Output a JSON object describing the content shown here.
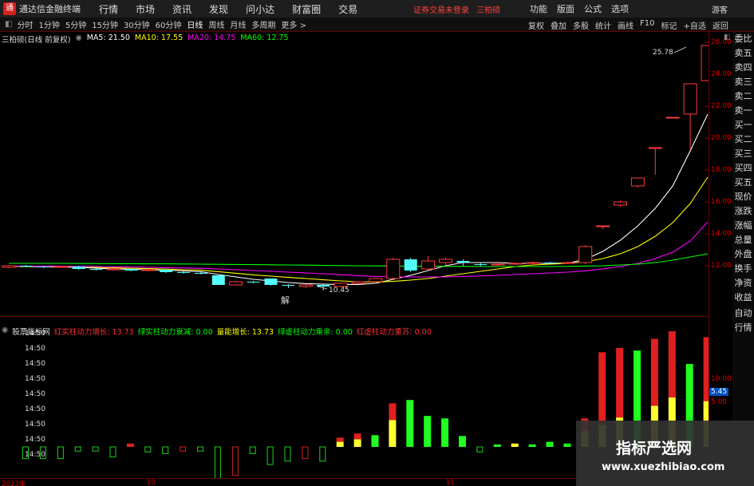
{
  "menubar": {
    "app_title": "通达信金融终端",
    "items": [
      "行情",
      "市场",
      "资讯",
      "发现",
      "问小达",
      "财富圈",
      "交易"
    ],
    "login_status": "证券交易未登录",
    "stock_label": "三柏硕",
    "right_items": [
      "功能",
      "版面",
      "公式",
      "选项"
    ],
    "guest": "游客"
  },
  "toolbar": {
    "periods": [
      "分时",
      "1分钟",
      "5分钟",
      "15分钟",
      "30分钟",
      "60分钟",
      "日线",
      "周线",
      "月线",
      "多周期",
      "更多 >"
    ],
    "active_period": "日线",
    "right_items": [
      "复权",
      "叠加",
      "多股",
      "统计",
      "画线",
      "F10",
      "标记",
      "+自选",
      "返回"
    ]
  },
  "info": {
    "stock_name": "三柏硕(日线 前复权)",
    "ma5": "MA5: 21.50",
    "ma10": "MA10: 17.55",
    "ma20": "MA20: 14.75",
    "ma60": "MA60: 12.75",
    "colors": {
      "ma5": "#ffffff",
      "ma10": "#ffff00",
      "ma20": "#ff00ff",
      "ma60": "#00ff00"
    }
  },
  "indicator": {
    "name": "股票指标网",
    "items": [
      {
        "label": "红实柱动力增长: 13.73",
        "color": "#ff3030"
      },
      {
        "label": "绿实柱动力衰减: 0.00",
        "color": "#00ff00"
      },
      {
        "label": "量能增长: 13.73",
        "color": "#ffff00"
      },
      {
        "label": "绿虚柱动力乘亲: 0.00",
        "color": "#00ff00"
      },
      {
        "label": "红虚柱动力重苏: 0.00",
        "color": "#ff3030"
      }
    ]
  },
  "price_axis": [
    "26.00",
    "24.00",
    "22.00",
    "20.00",
    "18.00",
    "16.00",
    "14.00",
    "12.00"
  ],
  "vol_axis": [
    "10.00",
    "5.00"
  ],
  "vol_current": "5.45",
  "high_label": "25.78",
  "low_label": "10.45",
  "marker_label": "解",
  "side_panel": [
    "委比",
    "卖五",
    "卖四",
    "卖三",
    "卖二",
    "卖一",
    "买一",
    "买二",
    "买三",
    "买四",
    "买五",
    "现价",
    "涨跌",
    "涨幅",
    "总量",
    "外盘",
    "换手",
    "净资",
    "收益",
    "自动",
    "行情"
  ],
  "time_labels": [
    "14:50",
    "14:50",
    "14:50",
    "14:50",
    "14:50",
    "14:50",
    "14:50",
    "14:50",
    "14:50"
  ],
  "date_axis": [
    "2023年",
    "10",
    "11"
  ],
  "watermark": {
    "title": "指标严选网",
    "url": "www.xuezhibiao.com"
  },
  "chart_data": [
    {
      "type": "candlestick",
      "title": "三柏硕(日线 前复权)",
      "ylim": [
        10,
        26.5
      ],
      "candles": [
        {
          "o": 11.9,
          "c": 12.0,
          "h": 12.05,
          "l": 11.85
        },
        {
          "o": 12.0,
          "c": 11.95,
          "h": 12.05,
          "l": 11.9
        },
        {
          "o": 11.95,
          "c": 11.9,
          "h": 12.0,
          "l": 11.85
        },
        {
          "o": 11.9,
          "c": 11.95,
          "h": 12.0,
          "l": 11.85
        },
        {
          "o": 11.95,
          "c": 11.8,
          "h": 12.0,
          "l": 11.75
        },
        {
          "o": 11.8,
          "c": 11.75,
          "h": 11.85,
          "l": 11.7
        },
        {
          "o": 11.75,
          "c": 11.8,
          "h": 11.85,
          "l": 11.7
        },
        {
          "o": 11.8,
          "c": 11.7,
          "h": 11.85,
          "l": 11.65
        },
        {
          "o": 11.7,
          "c": 11.75,
          "h": 11.8,
          "l": 11.65
        },
        {
          "o": 11.75,
          "c": 11.6,
          "h": 11.8,
          "l": 11.55
        },
        {
          "o": 11.6,
          "c": 11.55,
          "h": 11.65,
          "l": 11.5
        },
        {
          "o": 11.55,
          "c": 11.5,
          "h": 11.6,
          "l": 11.45
        },
        {
          "o": 11.4,
          "c": 10.8,
          "h": 11.4,
          "l": 10.8
        },
        {
          "o": 10.8,
          "c": 11.0,
          "h": 11.05,
          "l": 10.8
        },
        {
          "o": 11.0,
          "c": 10.95,
          "h": 11.05,
          "l": 10.9
        },
        {
          "o": 11.2,
          "c": 10.8,
          "h": 11.2,
          "l": 10.75
        },
        {
          "o": 10.8,
          "c": 10.75,
          "h": 10.85,
          "l": 10.6
        },
        {
          "o": 10.7,
          "c": 10.8,
          "h": 10.85,
          "l": 10.6
        },
        {
          "o": 10.8,
          "c": 10.7,
          "h": 10.85,
          "l": 10.45
        },
        {
          "o": 10.7,
          "c": 10.9,
          "h": 10.95,
          "l": 10.65
        },
        {
          "o": 10.9,
          "c": 11.0,
          "h": 11.05,
          "l": 10.85
        },
        {
          "o": 11.0,
          "c": 11.2,
          "h": 11.25,
          "l": 10.95
        },
        {
          "o": 11.2,
          "c": 12.4,
          "h": 12.5,
          "l": 11.2
        },
        {
          "o": 12.4,
          "c": 11.7,
          "h": 12.5,
          "l": 11.6
        },
        {
          "o": 11.8,
          "c": 12.3,
          "h": 12.6,
          "l": 11.7
        },
        {
          "o": 12.2,
          "c": 12.4,
          "h": 12.5,
          "l": 12.0
        },
        {
          "o": 12.3,
          "c": 12.2,
          "h": 12.4,
          "l": 12.0
        },
        {
          "o": 12.1,
          "c": 12.05,
          "h": 12.2,
          "l": 11.95
        },
        {
          "o": 12.05,
          "c": 12.1,
          "h": 12.2,
          "l": 12.0
        },
        {
          "o": 12.1,
          "c": 12.15,
          "h": 12.2,
          "l": 12.05
        },
        {
          "o": 12.15,
          "c": 12.2,
          "h": 12.25,
          "l": 12.1
        },
        {
          "o": 12.2,
          "c": 12.15,
          "h": 12.25,
          "l": 12.1
        },
        {
          "o": 12.15,
          "c": 12.2,
          "h": 12.25,
          "l": 12.1
        },
        {
          "o": 12.2,
          "c": 13.2,
          "h": 13.3,
          "l": 12.1
        },
        {
          "o": 14.5,
          "c": 14.5,
          "h": 14.5,
          "l": 14.3
        },
        {
          "o": 15.8,
          "c": 16.0,
          "h": 16.1,
          "l": 15.7
        },
        {
          "o": 17.0,
          "c": 17.5,
          "h": 17.5,
          "l": 16.9
        },
        {
          "o": 19.4,
          "c": 19.4,
          "h": 19.4,
          "l": 17.7
        },
        {
          "o": 21.3,
          "c": 21.3,
          "h": 21.3,
          "l": 21.3
        },
        {
          "o": 21.5,
          "c": 23.4,
          "h": 23.4,
          "l": 19.3
        },
        {
          "o": 23.6,
          "c": 25.8,
          "h": 25.78,
          "l": 23.6
        }
      ],
      "series": [
        {
          "name": "MA5",
          "color": "#ffffff",
          "values": [
            11.95,
            11.95,
            11.93,
            11.92,
            11.9,
            11.85,
            11.8,
            11.78,
            11.75,
            11.72,
            11.68,
            11.63,
            11.45,
            11.3,
            11.15,
            11.05,
            10.95,
            10.88,
            10.85,
            10.83,
            10.83,
            10.9,
            11.15,
            11.4,
            11.7,
            12.0,
            12.2,
            12.2,
            12.2,
            12.15,
            12.15,
            12.15,
            12.16,
            12.4,
            12.9,
            13.6,
            14.5,
            15.6,
            17.0,
            19.2,
            21.5
          ]
        },
        {
          "name": "MA10",
          "color": "#ffff00",
          "values": [
            11.96,
            11.96,
            11.95,
            11.94,
            11.93,
            11.9,
            11.87,
            11.84,
            11.82,
            11.79,
            11.75,
            11.72,
            11.63,
            11.53,
            11.43,
            11.35,
            11.27,
            11.2,
            11.12,
            11.05,
            11.0,
            10.98,
            11.02,
            11.1,
            11.2,
            11.35,
            11.5,
            11.65,
            11.8,
            11.95,
            12.05,
            12.1,
            12.15,
            12.25,
            12.45,
            12.75,
            13.2,
            13.85,
            14.7,
            15.9,
            17.55
          ]
        },
        {
          "name": "MA20",
          "color": "#ff00ff",
          "values": [
            11.98,
            11.98,
            11.97,
            11.97,
            11.96,
            11.95,
            11.93,
            11.92,
            11.9,
            11.88,
            11.86,
            11.84,
            11.8,
            11.75,
            11.7,
            11.65,
            11.6,
            11.55,
            11.5,
            11.44,
            11.38,
            11.33,
            11.3,
            11.3,
            11.3,
            11.3,
            11.33,
            11.36,
            11.4,
            11.45,
            11.5,
            11.55,
            11.6,
            11.68,
            11.8,
            11.95,
            12.15,
            12.45,
            12.85,
            13.55,
            14.75
          ]
        },
        {
          "name": "MA60",
          "color": "#00ff00",
          "values": [
            12.15,
            12.15,
            12.15,
            12.15,
            12.14,
            12.14,
            12.13,
            12.13,
            12.12,
            12.12,
            12.11,
            12.1,
            12.09,
            12.08,
            12.07,
            12.06,
            12.05,
            12.04,
            12.02,
            12.01,
            12.0,
            11.99,
            11.98,
            11.97,
            11.97,
            11.96,
            11.96,
            11.95,
            11.95,
            11.95,
            11.95,
            11.95,
            11.96,
            11.98,
            12.0,
            12.05,
            12.1,
            12.2,
            12.35,
            12.55,
            12.75
          ]
        }
      ]
    },
    {
      "type": "bar",
      "title": "股票指标网",
      "ylim": [
        -2,
        15
      ],
      "bars": [
        {
          "v": -1.4,
          "k": "greenHollow"
        },
        {
          "v": -1.4,
          "k": "greenHollow"
        },
        {
          "v": -1.4,
          "k": "greenHollow"
        },
        {
          "v": -0.5,
          "k": "greenHollow"
        },
        {
          "v": -0.5,
          "k": "greenHollow"
        },
        {
          "v": -1.2,
          "k": "greenHollow"
        },
        {
          "v": 0.4,
          "k": "redSolid"
        },
        {
          "v": -0.6,
          "k": "greenHollow"
        },
        {
          "v": -0.8,
          "k": "greenHollow"
        },
        {
          "v": -0.5,
          "k": "redHollow"
        },
        {
          "v": -0.5,
          "k": "greenHollow"
        },
        {
          "v": -3.8,
          "k": "greenHollow"
        },
        {
          "v": -3.4,
          "k": "redHollow"
        },
        {
          "v": -0.8,
          "k": "greenHollow"
        },
        {
          "v": -2.1,
          "k": "greenHollow"
        },
        {
          "v": -1.7,
          "k": "greenHollow"
        },
        {
          "v": -1.4,
          "k": "redHollow"
        },
        {
          "v": -1.7,
          "k": "greenHollow"
        },
        {
          "v": 1.1,
          "k": "redYellow",
          "y": 0.6
        },
        {
          "v": 1.6,
          "k": "redYellow",
          "y": 0.9
        },
        {
          "v": 1.4,
          "k": "greenSolid"
        },
        {
          "v": 5.2,
          "k": "redYellow",
          "y": 3.2
        },
        {
          "v": 5.6,
          "k": "greenSolid"
        },
        {
          "v": 3.7,
          "k": "greenSolid"
        },
        {
          "v": 3.4,
          "k": "greenSolid"
        },
        {
          "v": 1.3,
          "k": "greenSolid"
        },
        {
          "v": -0.6,
          "k": "greenHollow"
        },
        {
          "v": 0.3,
          "k": "greenSolid"
        },
        {
          "v": 0.4,
          "k": "yellowSolid"
        },
        {
          "v": 0.3,
          "k": "greenSolid"
        },
        {
          "v": 0.6,
          "k": "greenSolid"
        },
        {
          "v": 0.4,
          "k": "greenSolid"
        },
        {
          "v": 3.4,
          "k": "redYellow",
          "y": 1.9
        },
        {
          "v": 11.3,
          "k": "redYellow",
          "y": 2.6
        },
        {
          "v": 11.8,
          "k": "redYellow",
          "y": 3.5
        },
        {
          "v": 11.5,
          "k": "greenSolid"
        },
        {
          "v": 12.9,
          "k": "redYellow",
          "y": 4.9
        },
        {
          "v": 13.8,
          "k": "redYellow",
          "y": 5.9
        },
        {
          "v": 9.9,
          "k": "greenSolid"
        },
        {
          "v": 13.1,
          "k": "redYellow",
          "y": 5.45
        }
      ]
    }
  ]
}
